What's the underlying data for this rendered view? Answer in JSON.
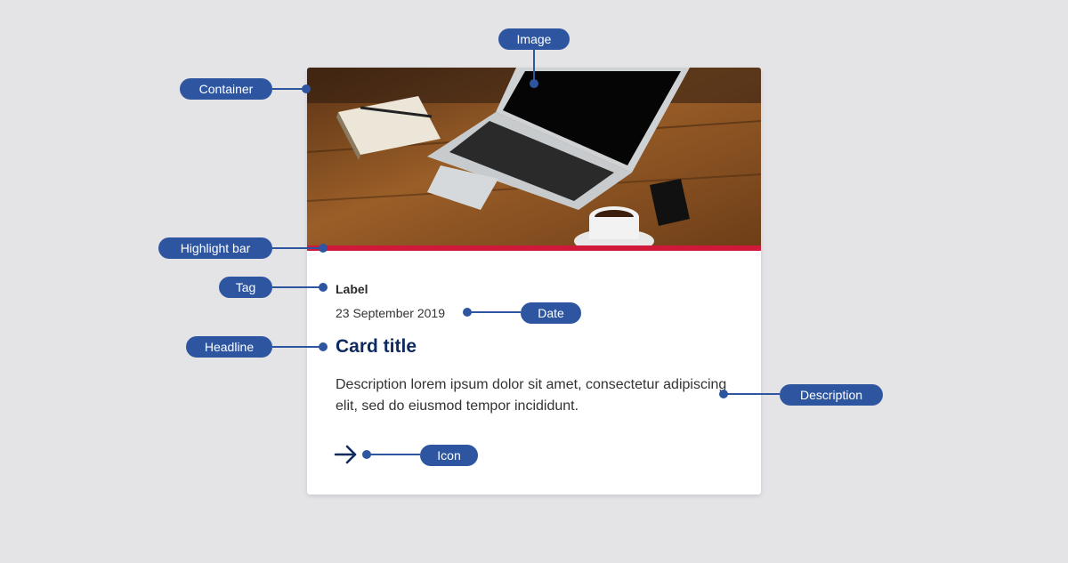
{
  "card": {
    "tag": "Label",
    "date": "23 September 2019",
    "title": "Card title",
    "description": "Description lorem ipsum dolor sit amet, consectetur adipiscing elit, sed do eiusmod tempor incididunt.",
    "icon": "arrow-right-icon"
  },
  "callouts": {
    "image": "Image",
    "container": "Container",
    "highlight_bar": "Highlight bar",
    "tag": "Tag",
    "date": "Date",
    "headline": "Headline",
    "description": "Description",
    "icon": "Icon"
  },
  "colors": {
    "background": "#e4e4e7",
    "callout": "#2e56a0",
    "highlight_bar": "#d0183a",
    "headline": "#0f2a5e"
  }
}
